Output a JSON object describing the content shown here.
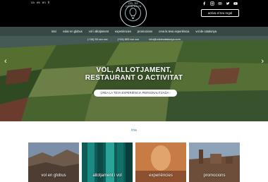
{
  "languages": [
    "ca",
    "es",
    "en",
    "fr"
  ],
  "logo": {
    "top_text": "CEL DE CATALUNYA",
    "bottom_text": ""
  },
  "social": [
    "facebook-icon",
    "instagram-icon",
    "tripadvisor-icon",
    "twitter-icon",
    "youtube-icon"
  ],
  "gift_button": "activa el teu regal",
  "nav": [
    "inici",
    "volar en globus",
    "vol i allotjament",
    "experiències",
    "promocions",
    "crea la teva experiència",
    "vol de catalunya"
  ],
  "contact": [
    "(+34) 93 xxx xxx",
    "(+34) 693 xxx xxx",
    "info@voldecatalunya.com"
  ],
  "hero": {
    "title_line1": "VOL, ALLOTJAMENT,",
    "title_line2": "RESTAURANT O ACTIVITAT",
    "cta": "CREA LA TEVA EXPERIÈNCIA PERSONALITZADA"
  },
  "section_title": "tria",
  "cards": [
    {
      "label": "vol en globus"
    },
    {
      "label": "allotjament i vol"
    },
    {
      "label": "experiències"
    },
    {
      "label": "promocions"
    }
  ],
  "colors": {
    "accent": "#3f8f9a",
    "topbar": "#000000"
  }
}
